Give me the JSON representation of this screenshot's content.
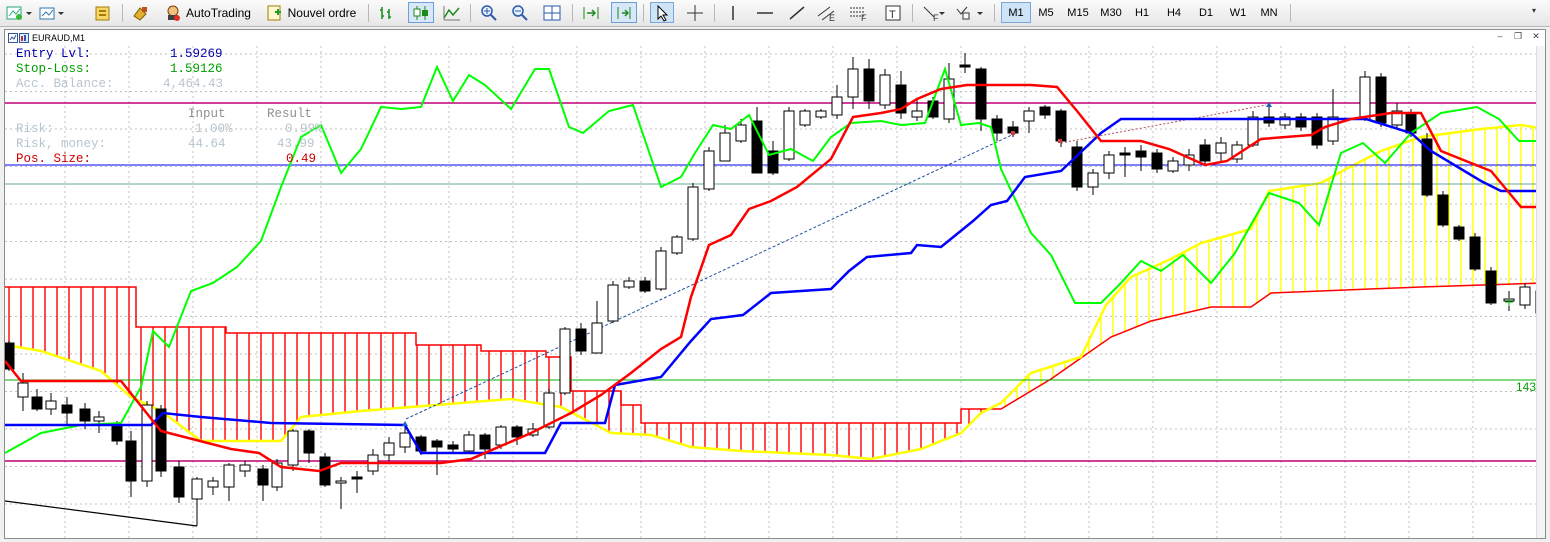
{
  "toolbar": {
    "autotrading_label": "AutoTrading",
    "new_order_label": "Nouvel ordre",
    "timeframes": [
      "M1",
      "M5",
      "M15",
      "M30",
      "H1",
      "H4",
      "D1",
      "W1",
      "MN"
    ],
    "active_timeframe": "M1"
  },
  "chart": {
    "symbol_title": "EURAUD,M1",
    "price_label_right": "143",
    "background": "#ffffff",
    "grid": true,
    "colors": {
      "up_candle": "#ffffff",
      "down_candle": "#000000",
      "tenkan": "#ff0000",
      "kijun": "#0000ff",
      "chikou": "#00ff00",
      "senkou_a": "#ffff00",
      "senkou_b": "#ff0000",
      "line_magenta": "#c0007a",
      "line_blue": "#0000ff",
      "line_green": "#00b000"
    }
  },
  "position_panel": {
    "entry_label": "Entry Lvl:",
    "entry_value": "1.59269",
    "stoploss_label": "Stop-Loss:",
    "stoploss_value": "1.59126",
    "balance_label": "Acc. Balance:",
    "balance_value": "4,464.43",
    "input_header": "Input",
    "result_header": "Result",
    "risk_label": "Risk:",
    "risk_input": "1.00%",
    "risk_result": "0.99%",
    "risk_money_label": "Risk, money:",
    "risk_money_input": "44.64",
    "risk_money_result": "43.99",
    "pos_size_label": "Pos. Size:",
    "pos_size_value": "0.49"
  }
}
